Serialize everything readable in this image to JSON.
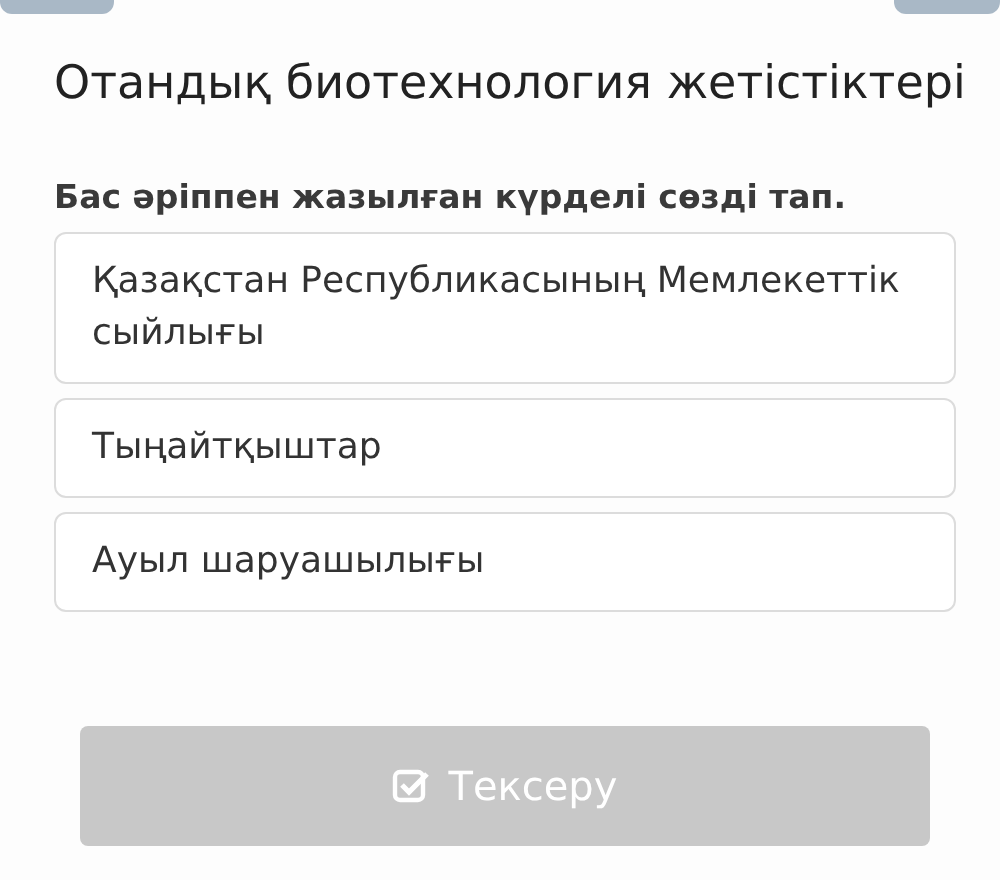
{
  "title": "Отандық биотехнология жетістіктері",
  "question": "Бас әріппен жазылған күрделі сөзді тап.",
  "options": [
    {
      "label": "Қазақстан Республикасының Мемлекеттік сыйлығы",
      "selected": false
    },
    {
      "label": "Тыңайтқыштар",
      "selected": false
    },
    {
      "label": "Ауыл шаруашылығы",
      "selected": false
    }
  ],
  "check_button": {
    "label": "Тексеру",
    "disabled": true
  }
}
